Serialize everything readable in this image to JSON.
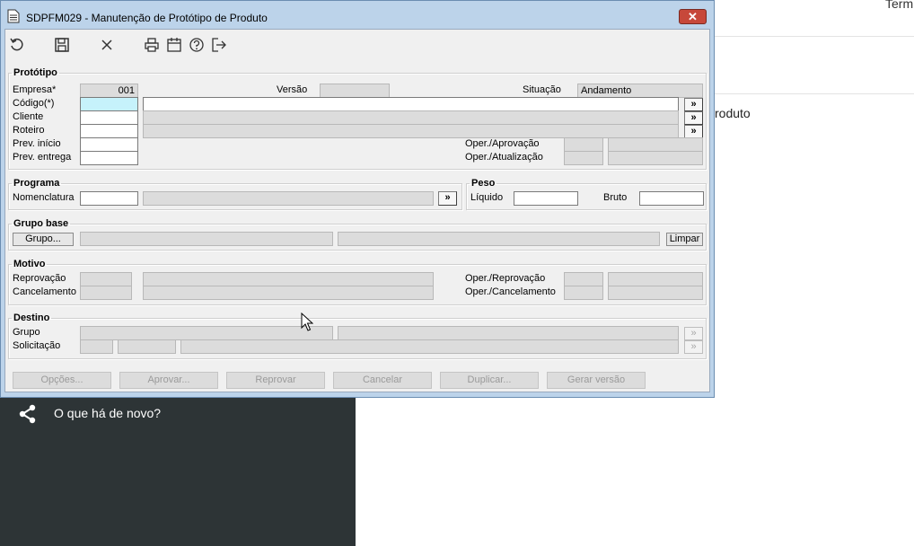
{
  "background": {
    "top_right_text": "Term",
    "section_text": "roduto",
    "sidebar_link": "O que há de novo?"
  },
  "window": {
    "title": "SDPFM029 - Manutenção de Protótipo de Produto",
    "close_label": "✕"
  },
  "toolbar": {
    "icons": [
      "undo-icon",
      "save-icon",
      "cancel-icon",
      "print-icon",
      "calendar-icon",
      "help-icon",
      "exit-icon"
    ]
  },
  "prototipo": {
    "legend": "Protótipo",
    "empresa_label": "Empresa*",
    "empresa_value": "001",
    "versao_label": "Versão",
    "versao_value": "",
    "situacao_label": "Situação",
    "situacao_value": "Andamento",
    "codigo_label": "Código(*)",
    "codigo_value": "",
    "cliente_label": "Cliente",
    "roteiro_label": "Roteiro",
    "prev_inicio_label": "Prev. início",
    "prev_entrega_label": "Prev. entrega",
    "oper_aprovacao_label": "Oper./Aprovação",
    "oper_atualizacao_label": "Oper./Atualização",
    "pick_label": "»"
  },
  "programa": {
    "legend": "Programa",
    "nomenclatura_label": "Nomenclatura",
    "pick_label": "»"
  },
  "peso": {
    "legend": "Peso",
    "liquido_label": "Líquido",
    "bruto_label": "Bruto"
  },
  "grupo_base": {
    "legend": "Grupo base",
    "grupo_button": "Grupo...",
    "limpar_button": "Limpar"
  },
  "motivo": {
    "legend": "Motivo",
    "reprovacao_label": "Reprovação",
    "cancelamento_label": "Cancelamento",
    "oper_reprovacao_label": "Oper./Reprovação",
    "oper_cancelamento_label": "Oper./Cancelamento"
  },
  "destino": {
    "legend": "Destino",
    "grupo_label": "Grupo",
    "solicitacao_label": "Solicitação",
    "pick_label": "»"
  },
  "actions": {
    "opcoes": "Opções...",
    "aprovar": "Aprovar...",
    "reprovar": "Reprovar",
    "cancelar": "Cancelar",
    "duplicar": "Duplicar...",
    "gerar_versao": "Gerar versão"
  },
  "colors": {
    "window_frame": "#bcd3ea",
    "client_bg": "#f0f0f0",
    "readonly_field": "#dcdcdc",
    "focused_field": "#c6f2fb",
    "close_button": "#c7483a",
    "dark_panel": "#2d3436"
  }
}
